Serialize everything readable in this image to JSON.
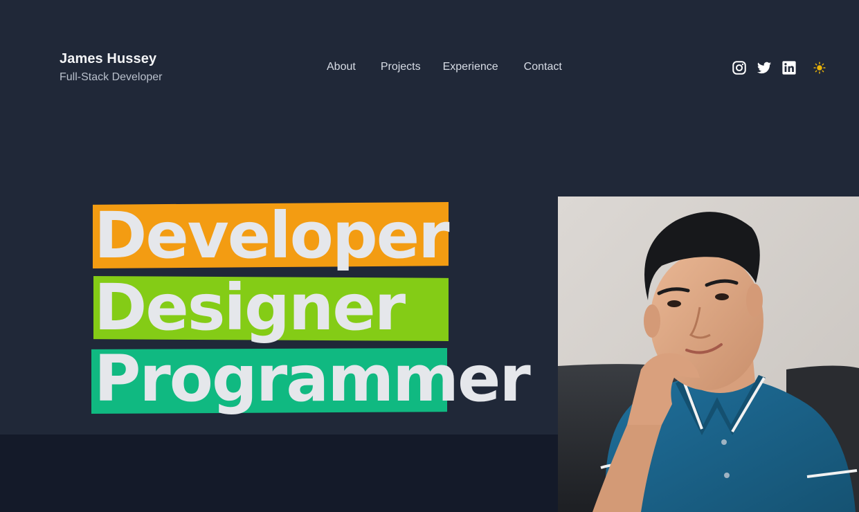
{
  "header": {
    "name": "James Hussey",
    "role": "Full-Stack Developer"
  },
  "nav": {
    "items": [
      {
        "label": "About"
      },
      {
        "label": "Projects"
      },
      {
        "label": "Experience"
      },
      {
        "label": "Contact"
      }
    ]
  },
  "social": {
    "icons": [
      "instagram-icon",
      "twitter-icon",
      "linkedin-icon"
    ],
    "theme_toggle_icon": "sun-icon"
  },
  "hero": {
    "words": [
      "Developer",
      "Designer",
      "Programmer"
    ],
    "highlight_colors": [
      "#f39c12",
      "#84cc16",
      "#10b981"
    ]
  },
  "colors": {
    "background": "#202838",
    "background_lower": "#141a29",
    "text": "#e5e7eb",
    "sun": "#eab308"
  }
}
